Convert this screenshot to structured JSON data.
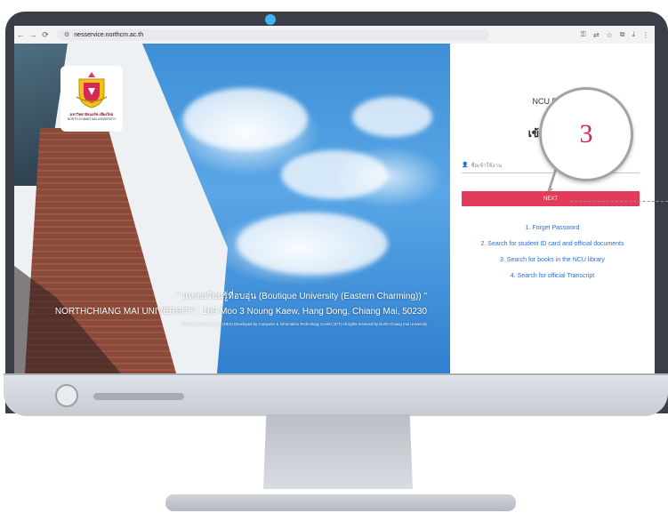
{
  "browser": {
    "url": "nesservice.northcm.ac.th",
    "nav_back": "←",
    "nav_forward": "→",
    "nav_reload": "⟳",
    "icons": [
      "key-icon",
      "translate-icon",
      "star-icon",
      "extensions-icon",
      "download-icon",
      "menu-icon"
    ]
  },
  "logo": {
    "name_th": "มหาวิทยาลัยนอร์ท-เชียงใหม่",
    "name_en": "NORTH-CHIANG MAI UNIVERSITY"
  },
  "hero": {
    "slogan": "\" แหล่งเรียนรู้ที่อบอุ่น (Boutique University (Eastern Charming)) \"",
    "address": "NORTHCHIANG MAI UNIVERSITY : 169 Moo 3 Noung Kaew, Hang Dong, Chiang Mai, 50230",
    "copyright": "New Education Service (NES) Developed by Computer & Information Technology Center (ICT) All rights reserved by North-Chiang mai University"
  },
  "login": {
    "title": "NCU Eagle",
    "subtitle": "เข้าสู่ระบบ",
    "username_placeholder": "ชื่อเข้าใช้งาน",
    "next_label": "NEXT",
    "links": [
      "1. Forget Password",
      "2. Search for student ID card and official documents",
      "3. Search for books in the NCU library",
      "4. Search for official Transcript"
    ]
  },
  "callout": {
    "number": "3"
  },
  "colors": {
    "next_button": "#e53b5b",
    "link": "#2a6fd6",
    "callout_number": "#d0284a",
    "camera": "#3fb4f0"
  }
}
